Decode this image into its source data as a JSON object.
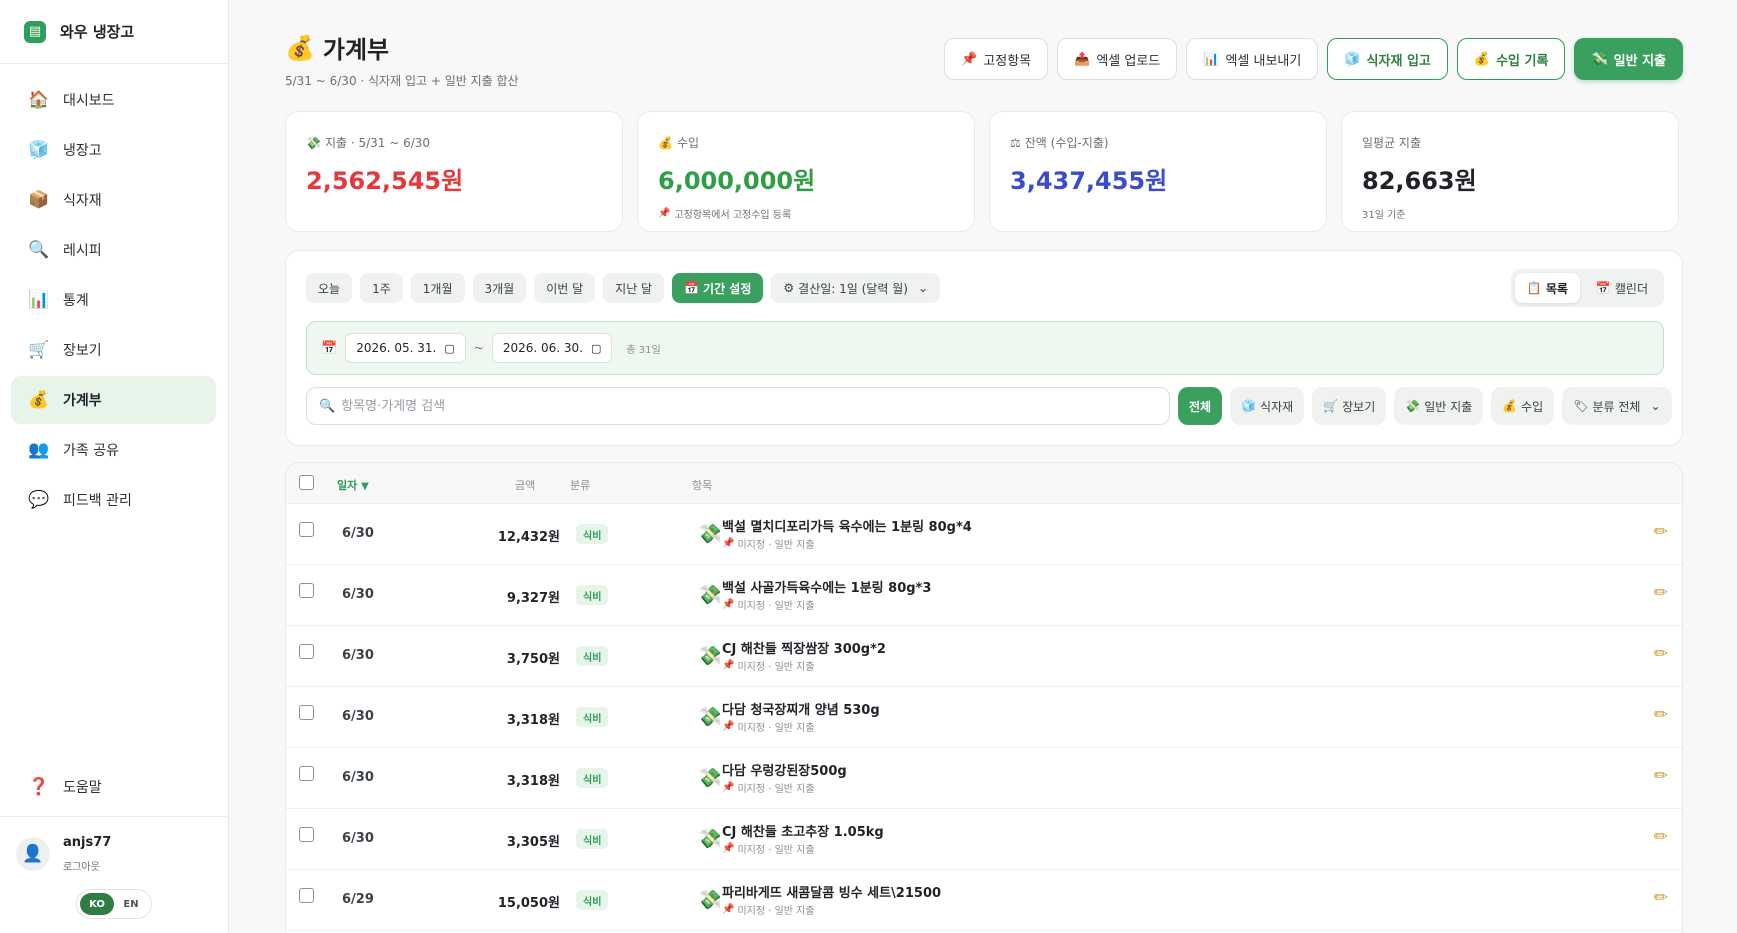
{
  "brand": {
    "name": "와우 냉장고",
    "logo_icon": "fridge-icon"
  },
  "sidebar": {
    "items": [
      {
        "label": "대시보드",
        "icon": "🏠",
        "name": "home-icon"
      },
      {
        "label": "냉장고",
        "icon": "🧊",
        "name": "fridge-icon"
      },
      {
        "label": "식자재",
        "icon": "📦",
        "name": "box-icon"
      },
      {
        "label": "레시피",
        "icon": "🔍",
        "name": "magnifier-icon"
      },
      {
        "label": "통계",
        "icon": "📊",
        "name": "chart-icon"
      },
      {
        "label": "장보기",
        "icon": "🛒",
        "name": "cart-icon"
      },
      {
        "label": "가계부",
        "icon": "💰",
        "name": "money-bag-icon"
      },
      {
        "label": "가족 공유",
        "icon": "👥",
        "name": "people-icon"
      },
      {
        "label": "피드백 관리",
        "icon": "💬",
        "name": "chat-icon"
      }
    ],
    "help": {
      "label": "도움말",
      "icon": "❓"
    },
    "user": {
      "name": "anjs77",
      "logout": "로그아웃",
      "avatar_icon": "👤"
    },
    "lang": {
      "ko": "KO",
      "en": "EN"
    }
  },
  "header": {
    "title": "가계부",
    "title_icon": "💰",
    "subtitle": "5/31 ~ 6/30 · 식자재 입고 + 일반 지출 합산"
  },
  "toolbar": [
    {
      "label": "고정항목",
      "icon": "📌",
      "style": "plain"
    },
    {
      "label": "엑셀 업로드",
      "icon": "📤",
      "style": "plain"
    },
    {
      "label": "엑셀 내보내기",
      "icon": "📊",
      "style": "plain"
    },
    {
      "label": "식자재 입고",
      "icon": "🧊",
      "style": "outline"
    },
    {
      "label": "수입 기록",
      "icon": "💰",
      "style": "outline"
    },
    {
      "label": "일반 지출",
      "icon": "💸",
      "style": "solid"
    }
  ],
  "cards": [
    {
      "label": "지출 · 5/31 ~ 6/30",
      "icon": "💸",
      "value": "2,562,545원",
      "color": "#e5383b",
      "note": "",
      "note_icon": ""
    },
    {
      "label": "수입",
      "icon": "💰",
      "value": "6,000,000원",
      "color": "#2f9e44",
      "note": "고정항목에서 고정수입 등록",
      "note_icon": "📌"
    },
    {
      "label": "잔액 (수입-지출)",
      "icon": "⚖",
      "value": "3,437,455원",
      "color": "#3b4cca",
      "note": "",
      "note_icon": ""
    },
    {
      "label": "일평균 지출",
      "icon": "",
      "value": "82,663원",
      "color": "#1f2328",
      "note": "31일 기준",
      "note_icon": ""
    }
  ],
  "filters": {
    "periods": [
      "오늘",
      "1주",
      "1개월",
      "3개월",
      "이번 달",
      "지난 달"
    ],
    "period_custom": {
      "label": "기간 설정",
      "icon": "📅"
    },
    "settlement": {
      "label": "결산일: 1일 (달력 월)",
      "icon": "⚙"
    },
    "view": [
      {
        "label": "목록",
        "icon": "📋",
        "active": true
      },
      {
        "label": "캘린더",
        "icon": "📅",
        "active": false
      }
    ],
    "date_from": "2026. 05. 31.",
    "date_to": "2026. 06. 30.",
    "date_sep": "~",
    "total_days": "총 31일",
    "search_placeholder": "항목명·가게명 검색",
    "types": [
      {
        "label": "전체",
        "icon": "",
        "active": true
      },
      {
        "label": "식자재",
        "icon": "🧊",
        "active": false
      },
      {
        "label": "장보기",
        "icon": "🛒",
        "active": false
      },
      {
        "label": "일반 지출",
        "icon": "💸",
        "active": false
      },
      {
        "label": "수입",
        "icon": "💰",
        "active": false
      }
    ],
    "category_select": {
      "label": "분류 전체",
      "icon": "🏷"
    }
  },
  "table": {
    "headers": {
      "date": "일자",
      "sort_indicator": "▼",
      "amount": "금액",
      "category": "분류",
      "item": "항목"
    },
    "rows": [
      {
        "date": "6/30",
        "amount": "12,432원",
        "category": "식비",
        "name": "백설 멸치디포리가득 육수에는 1분링 80g*4",
        "sub": "미지정 · 일반 지출"
      },
      {
        "date": "6/30",
        "amount": "9,327원",
        "category": "식비",
        "name": "백설 사골가득육수에는 1분링 80g*3",
        "sub": "미지정 · 일반 지출"
      },
      {
        "date": "6/30",
        "amount": "3,750원",
        "category": "식비",
        "name": "CJ 해찬들 찍장쌈장 300g*2",
        "sub": "미지정 · 일반 지출"
      },
      {
        "date": "6/30",
        "amount": "3,318원",
        "category": "식비",
        "name": "다담 청국장찌개 양념 530g",
        "sub": "미지정 · 일반 지출"
      },
      {
        "date": "6/30",
        "amount": "3,318원",
        "category": "식비",
        "name": "다담 우렁강된장500g",
        "sub": "미지정 · 일반 지출"
      },
      {
        "date": "6/30",
        "amount": "3,305원",
        "category": "식비",
        "name": "CJ 해찬들 초고추장 1.05kg",
        "sub": "미지정 · 일반 지출"
      },
      {
        "date": "6/29",
        "amount": "15,050원",
        "category": "식비",
        "name": "파리바게뜨 새콤달콤 빙수 세트\\21500",
        "sub": "미지정 · 일반 지출"
      }
    ],
    "row_icon": "💸",
    "sub_icon": "📌",
    "edit_icon": "✏"
  }
}
